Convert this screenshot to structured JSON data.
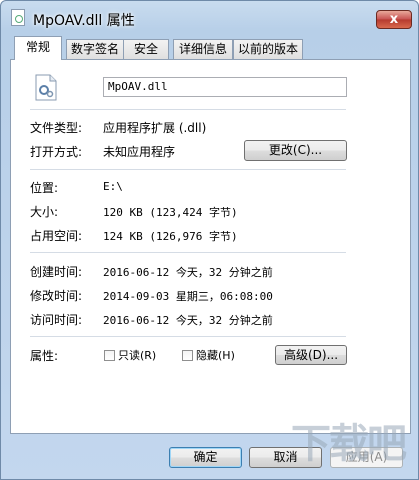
{
  "window": {
    "title": "MpOAV.dll 属性",
    "close_label": "x"
  },
  "tabs": [
    {
      "label": "常规",
      "active": true
    },
    {
      "label": "数字签名",
      "active": false
    },
    {
      "label": "安全",
      "active": false
    },
    {
      "label": "详细信息",
      "active": false
    },
    {
      "label": "以前的版本",
      "active": false
    }
  ],
  "general": {
    "filename": "MpOAV.dll",
    "file_type_label": "文件类型:",
    "file_type_value": "应用程序扩展 (.dll)",
    "opens_with_label": "打开方式:",
    "opens_with_value": "未知应用程序",
    "change_button": "更改(C)...",
    "location_label": "位置:",
    "location_value": "E:\\",
    "size_label": "大小:",
    "size_value": "120 KB (123,424 字节)",
    "size_on_disk_label": "占用空间:",
    "size_on_disk_value": "124 KB (126,976 字节)",
    "created_label": "创建时间:",
    "created_value": "2016-06-12 今天，32 分钟之前",
    "modified_label": "修改时间:",
    "modified_value": "2014-09-03 星期三，06:08:00",
    "accessed_label": "访问时间:",
    "accessed_value": "2016-06-12 今天，32 分钟之前",
    "attributes_label": "属性:",
    "readonly_label": "只读(R)",
    "hidden_label": "隐藏(H)",
    "advanced_button": "高级(D)..."
  },
  "footer": {
    "ok_button": "确定",
    "cancel_button": "取消",
    "apply_button": "应用(A)"
  },
  "watermark": "下载吧"
}
